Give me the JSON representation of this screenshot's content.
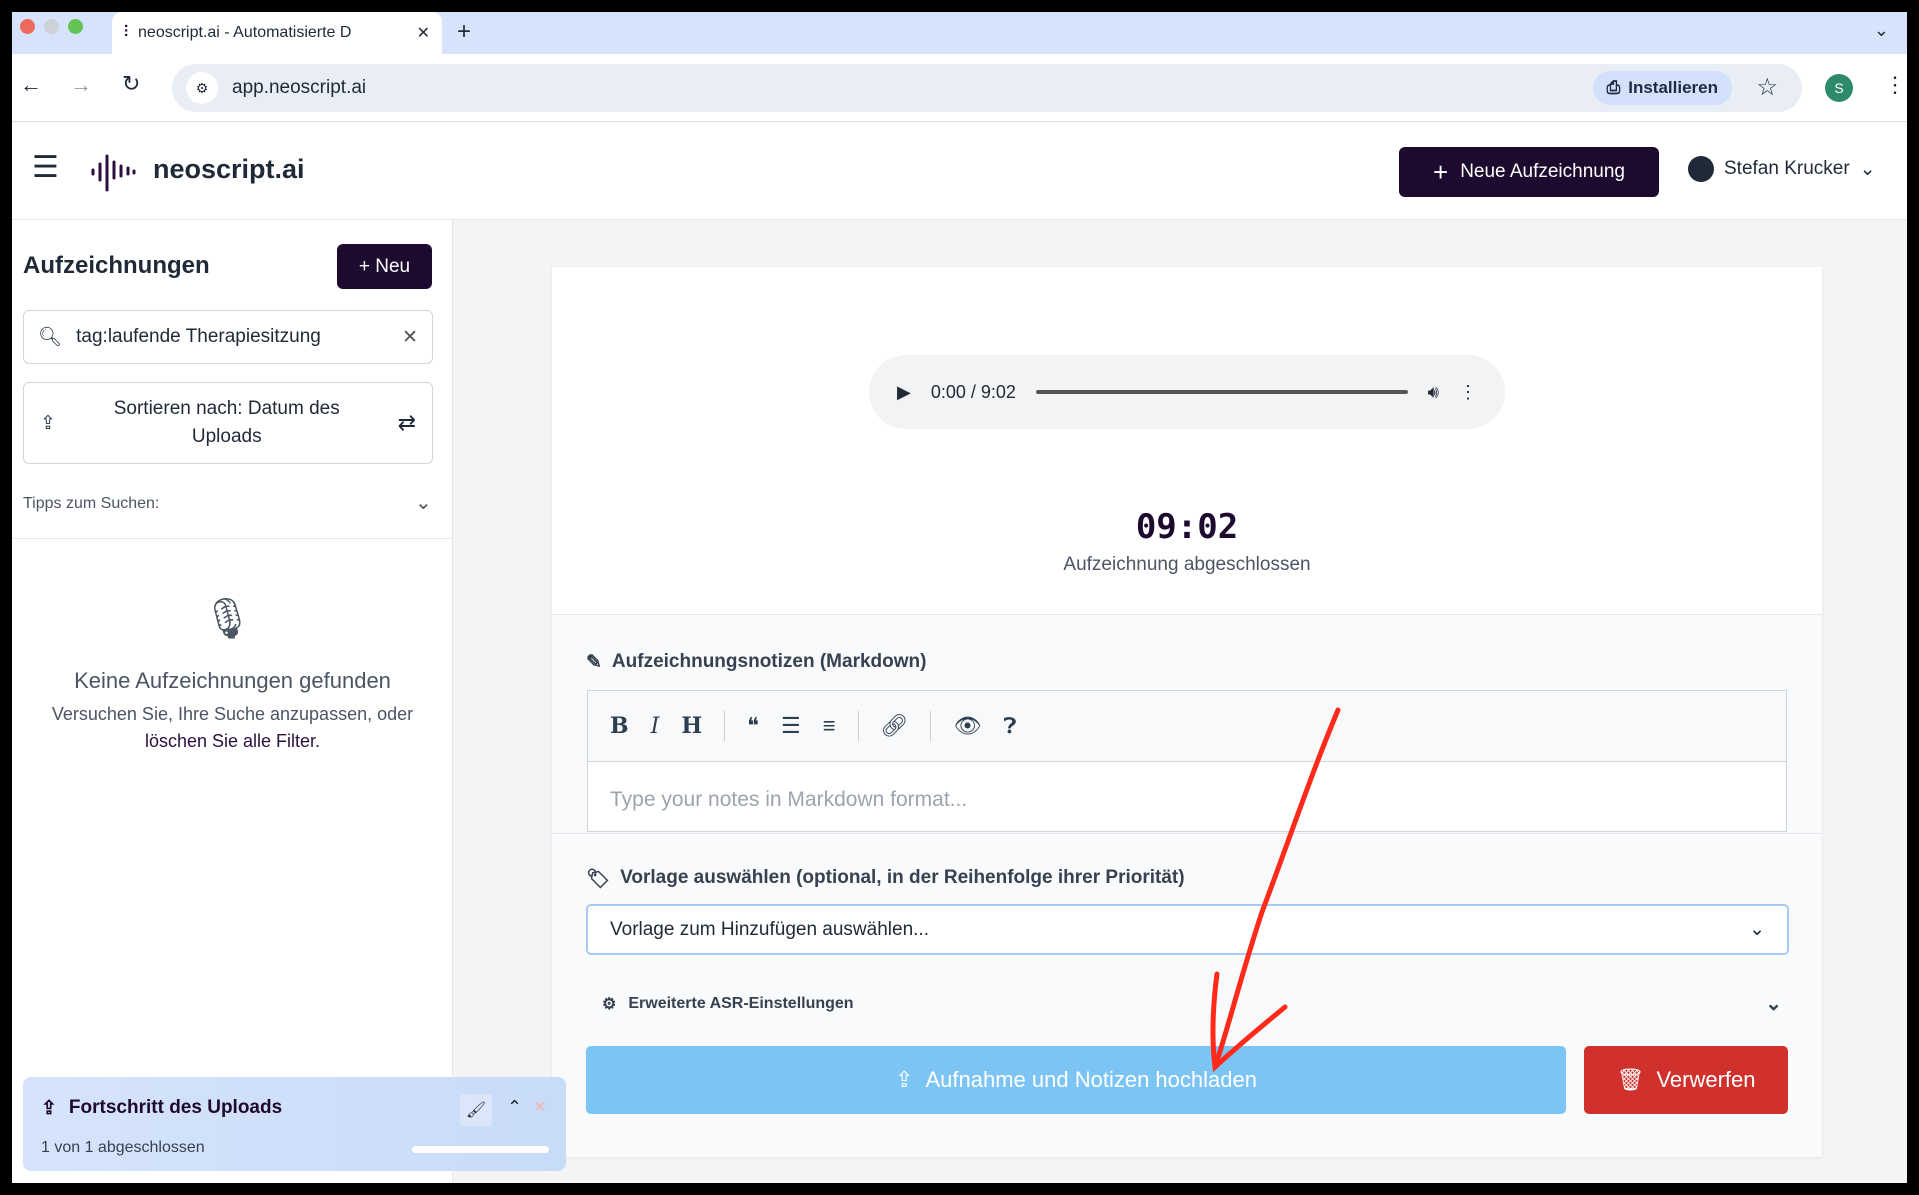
{
  "browser": {
    "tab_title": "neoscript.ai - Automatisierte D",
    "url": "app.neoscript.ai",
    "install_label": "Installieren",
    "profile_initial": "S"
  },
  "header": {
    "brand": "neoscript.ai",
    "new_recording": "Neue Aufzeichnung",
    "user_name": "Stefan Krucker"
  },
  "sidebar": {
    "title": "Aufzeichnungen",
    "new_label": "Neu",
    "search_value": "tag:laufende Therapiesitzung",
    "sort_label": "Sortieren nach: Datum des Uploads",
    "tips_label": "Tipps zum Suchen:",
    "empty_title": "Keine Aufzeichnungen gefunden",
    "empty_text": "Versuchen Sie, Ihre Suche anzupassen, oder",
    "empty_link": "löschen Sie alle Filter."
  },
  "player": {
    "time": "0:00 / 9:02",
    "progress": 0
  },
  "recording": {
    "duration": "09:02",
    "status": "Aufzeichnung abgeschlossen"
  },
  "notes": {
    "label": "Aufzeichnungsnotizen (Markdown)",
    "placeholder": "Type your notes in Markdown format...",
    "toolbar": [
      "B",
      "I",
      "H"
    ]
  },
  "template": {
    "label": "Vorlage auswählen (optional, in der Reihenfolge ihrer Priorität)",
    "selected": "Vorlage zum Hinzufügen auswählen..."
  },
  "asr": {
    "label": "Erweiterte ASR-Einstellungen"
  },
  "actions": {
    "upload": "Aufnahme und Notizen hochladen",
    "discard": "Verwerfen"
  },
  "upload_panel": {
    "title": "Fortschritt des Uploads",
    "status": "1 von 1 abgeschlossen",
    "progress": 1.0
  },
  "colors": {
    "brand": "#1e0a2e",
    "upload": "#7cc4f4",
    "discard": "#d0312d",
    "annotation": "#ff2a1a"
  }
}
